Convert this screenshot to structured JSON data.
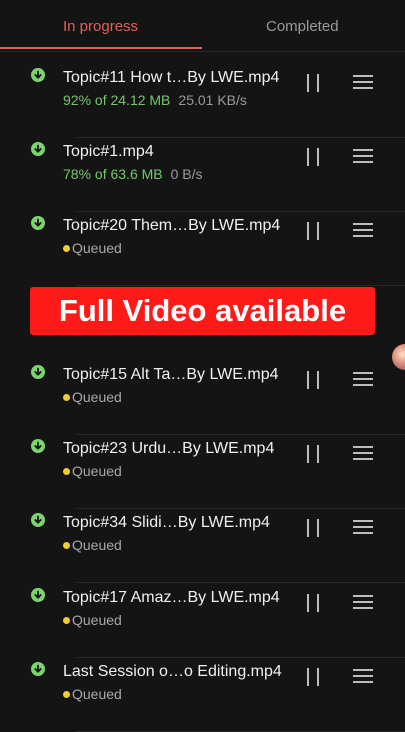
{
  "tabs": {
    "in_progress": "In progress",
    "completed": "Completed"
  },
  "banner": {
    "text": "Full Video available"
  },
  "downloads": [
    {
      "name": "Topic#11 How t…By LWE.mp4",
      "progress": "92% of 24.12 MB",
      "speed": "25.01 KB/s"
    },
    {
      "name": "Topic#1.mp4",
      "progress": "78% of 63.6 MB",
      "speed": "0 B/s"
    },
    {
      "name": "Topic#20 Them…By LWE.mp4",
      "status": "Queued"
    },
    {
      "name": "Topic#15 Alt Ta…By LWE.mp4",
      "status": "Queued"
    },
    {
      "name": "Topic#23 Urdu…By LWE.mp4",
      "status": "Queued"
    },
    {
      "name": "Topic#34  Slidi…By LWE.mp4",
      "status": "Queued"
    },
    {
      "name": "Topic#17 Amaz…By LWE.mp4",
      "status": "Queued"
    },
    {
      "name": "Last Session o…o Editing.mp4",
      "status": "Queued"
    }
  ],
  "colors": {
    "accent": "#e0605a",
    "progress_green": "#74c86a",
    "queued_dot": "#f2cc2e",
    "banner_bg": "#ff1a1a"
  },
  "icons": {
    "status": "download-arrow-icon",
    "pause": "pause-icon",
    "reorder": "drag-handle-icon",
    "floating": "floating-avatar-icon"
  }
}
